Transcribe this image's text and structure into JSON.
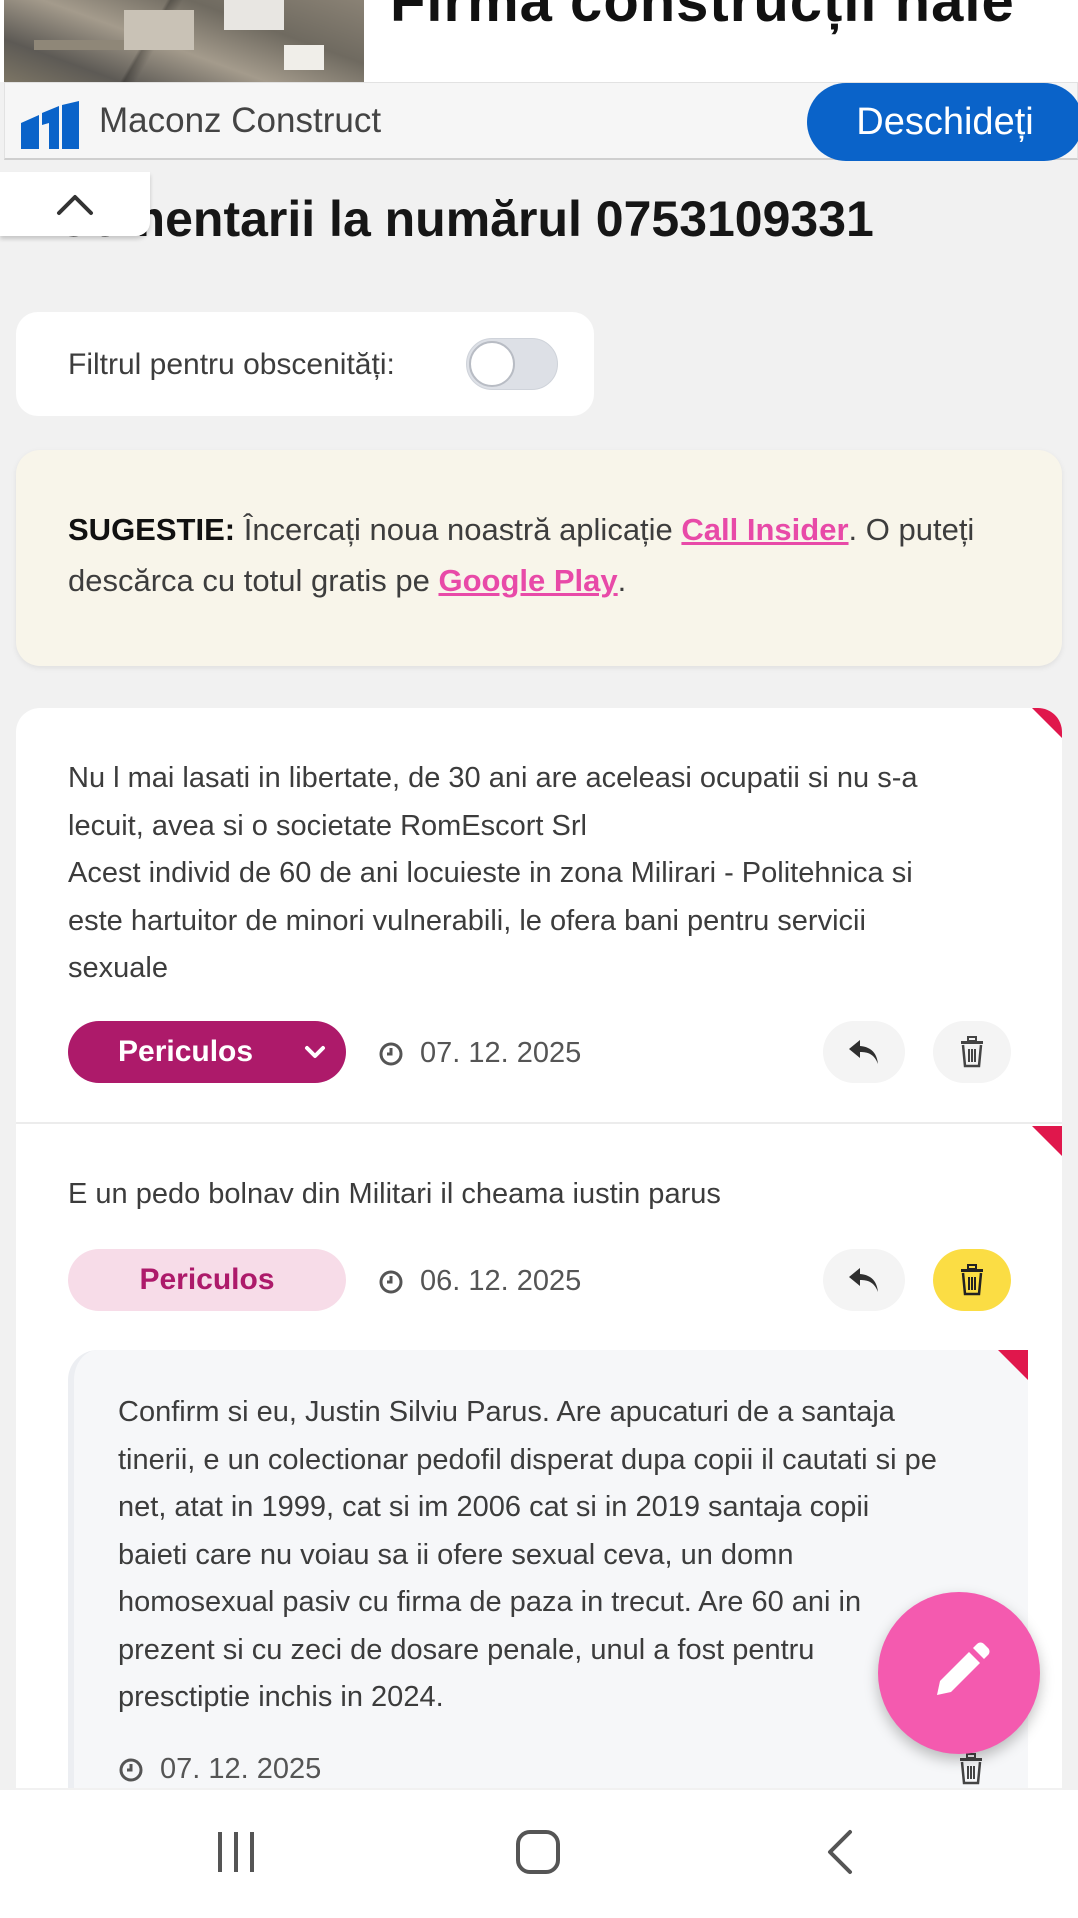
{
  "ad": {
    "headline": "Firma construcții hale",
    "brand": "Maconz Construct",
    "open_label": "Deschideți",
    "brand_color": "#0a63c9"
  },
  "page": {
    "title": "Comentarii la numărul 0753109331"
  },
  "filter": {
    "label": "Filtrul pentru obscenități:",
    "enabled": false
  },
  "tip": {
    "bold": "SUGESTIE:",
    "text_before": " Încercați noua noastră aplicație ",
    "link1": "Call Insider",
    "text_mid": ". O puteți descărca cu totul gratis pe ",
    "link2": "Google Play",
    "text_end": "."
  },
  "comments": [
    {
      "lines": [
        "Nu l mai lasati in libertate, de 30 ani are aceleasi ocupatii si nu s-a",
        "lecuit, avea si o societate RomEscort Srl",
        "Acest individ de 60 de ani locuieste in zona Milirari - Politehnica si",
        "este hartuitor de minori vulnerabili, le ofera bani pentru servicii",
        "sexuale"
      ],
      "rating": "Periculos",
      "date": "07. 12. 2025"
    },
    {
      "lines": [
        "E un pedo bolnav din Militari il cheama iustin parus"
      ],
      "rating": "Periculos",
      "date": "06. 12. 2025"
    }
  ],
  "reply": {
    "lines": [
      "Confirm si eu, Justin Silviu Parus. Are apucaturi de a santaja",
      "tinerii, e un colectionar pedofil disperat dupa copii il cautati si pe",
      "net, atat in 1999, cat si im 2006 cat si in 2019 santaja copii",
      "baieti care nu voiau sa ii ofere sexual ceva, un domn",
      "homosexual pasiv cu firma de paza in trecut. Are 60 ani in",
      "prezent si cu zeci de dosare penale, unul a fost pentru",
      "presctiptie inchis in 2024."
    ],
    "date": "07. 12. 2025"
  },
  "colors": {
    "rating_dark": "#ad1a6a",
    "rating_light": "#f7dce8",
    "fab": "#f45aaf",
    "flag": "#e0174c",
    "link": "#e84aa8"
  }
}
